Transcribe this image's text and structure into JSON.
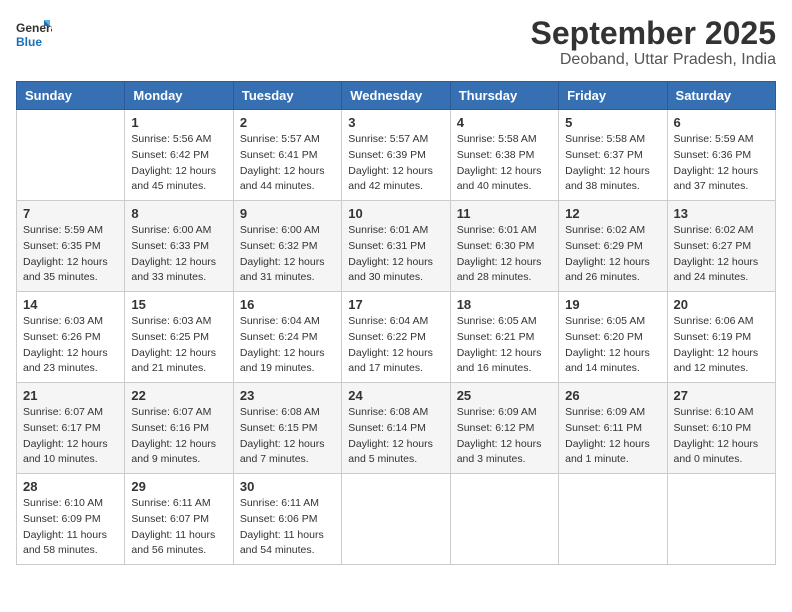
{
  "logo": {
    "text_general": "General",
    "text_blue": "Blue"
  },
  "title": "September 2025",
  "subtitle": "Deoband, Uttar Pradesh, India",
  "days_of_week": [
    "Sunday",
    "Monday",
    "Tuesday",
    "Wednesday",
    "Thursday",
    "Friday",
    "Saturday"
  ],
  "weeks": [
    [
      {
        "day": "",
        "info": ""
      },
      {
        "day": "1",
        "info": "Sunrise: 5:56 AM\nSunset: 6:42 PM\nDaylight: 12 hours\nand 45 minutes."
      },
      {
        "day": "2",
        "info": "Sunrise: 5:57 AM\nSunset: 6:41 PM\nDaylight: 12 hours\nand 44 minutes."
      },
      {
        "day": "3",
        "info": "Sunrise: 5:57 AM\nSunset: 6:39 PM\nDaylight: 12 hours\nand 42 minutes."
      },
      {
        "day": "4",
        "info": "Sunrise: 5:58 AM\nSunset: 6:38 PM\nDaylight: 12 hours\nand 40 minutes."
      },
      {
        "day": "5",
        "info": "Sunrise: 5:58 AM\nSunset: 6:37 PM\nDaylight: 12 hours\nand 38 minutes."
      },
      {
        "day": "6",
        "info": "Sunrise: 5:59 AM\nSunset: 6:36 PM\nDaylight: 12 hours\nand 37 minutes."
      }
    ],
    [
      {
        "day": "7",
        "info": "Sunrise: 5:59 AM\nSunset: 6:35 PM\nDaylight: 12 hours\nand 35 minutes."
      },
      {
        "day": "8",
        "info": "Sunrise: 6:00 AM\nSunset: 6:33 PM\nDaylight: 12 hours\nand 33 minutes."
      },
      {
        "day": "9",
        "info": "Sunrise: 6:00 AM\nSunset: 6:32 PM\nDaylight: 12 hours\nand 31 minutes."
      },
      {
        "day": "10",
        "info": "Sunrise: 6:01 AM\nSunset: 6:31 PM\nDaylight: 12 hours\nand 30 minutes."
      },
      {
        "day": "11",
        "info": "Sunrise: 6:01 AM\nSunset: 6:30 PM\nDaylight: 12 hours\nand 28 minutes."
      },
      {
        "day": "12",
        "info": "Sunrise: 6:02 AM\nSunset: 6:29 PM\nDaylight: 12 hours\nand 26 minutes."
      },
      {
        "day": "13",
        "info": "Sunrise: 6:02 AM\nSunset: 6:27 PM\nDaylight: 12 hours\nand 24 minutes."
      }
    ],
    [
      {
        "day": "14",
        "info": "Sunrise: 6:03 AM\nSunset: 6:26 PM\nDaylight: 12 hours\nand 23 minutes."
      },
      {
        "day": "15",
        "info": "Sunrise: 6:03 AM\nSunset: 6:25 PM\nDaylight: 12 hours\nand 21 minutes."
      },
      {
        "day": "16",
        "info": "Sunrise: 6:04 AM\nSunset: 6:24 PM\nDaylight: 12 hours\nand 19 minutes."
      },
      {
        "day": "17",
        "info": "Sunrise: 6:04 AM\nSunset: 6:22 PM\nDaylight: 12 hours\nand 17 minutes."
      },
      {
        "day": "18",
        "info": "Sunrise: 6:05 AM\nSunset: 6:21 PM\nDaylight: 12 hours\nand 16 minutes."
      },
      {
        "day": "19",
        "info": "Sunrise: 6:05 AM\nSunset: 6:20 PM\nDaylight: 12 hours\nand 14 minutes."
      },
      {
        "day": "20",
        "info": "Sunrise: 6:06 AM\nSunset: 6:19 PM\nDaylight: 12 hours\nand 12 minutes."
      }
    ],
    [
      {
        "day": "21",
        "info": "Sunrise: 6:07 AM\nSunset: 6:17 PM\nDaylight: 12 hours\nand 10 minutes."
      },
      {
        "day": "22",
        "info": "Sunrise: 6:07 AM\nSunset: 6:16 PM\nDaylight: 12 hours\nand 9 minutes."
      },
      {
        "day": "23",
        "info": "Sunrise: 6:08 AM\nSunset: 6:15 PM\nDaylight: 12 hours\nand 7 minutes."
      },
      {
        "day": "24",
        "info": "Sunrise: 6:08 AM\nSunset: 6:14 PM\nDaylight: 12 hours\nand 5 minutes."
      },
      {
        "day": "25",
        "info": "Sunrise: 6:09 AM\nSunset: 6:12 PM\nDaylight: 12 hours\nand 3 minutes."
      },
      {
        "day": "26",
        "info": "Sunrise: 6:09 AM\nSunset: 6:11 PM\nDaylight: 12 hours\nand 1 minute."
      },
      {
        "day": "27",
        "info": "Sunrise: 6:10 AM\nSunset: 6:10 PM\nDaylight: 12 hours\nand 0 minutes."
      }
    ],
    [
      {
        "day": "28",
        "info": "Sunrise: 6:10 AM\nSunset: 6:09 PM\nDaylight: 11 hours\nand 58 minutes."
      },
      {
        "day": "29",
        "info": "Sunrise: 6:11 AM\nSunset: 6:07 PM\nDaylight: 11 hours\nand 56 minutes."
      },
      {
        "day": "30",
        "info": "Sunrise: 6:11 AM\nSunset: 6:06 PM\nDaylight: 11 hours\nand 54 minutes."
      },
      {
        "day": "",
        "info": ""
      },
      {
        "day": "",
        "info": ""
      },
      {
        "day": "",
        "info": ""
      },
      {
        "day": "",
        "info": ""
      }
    ]
  ]
}
